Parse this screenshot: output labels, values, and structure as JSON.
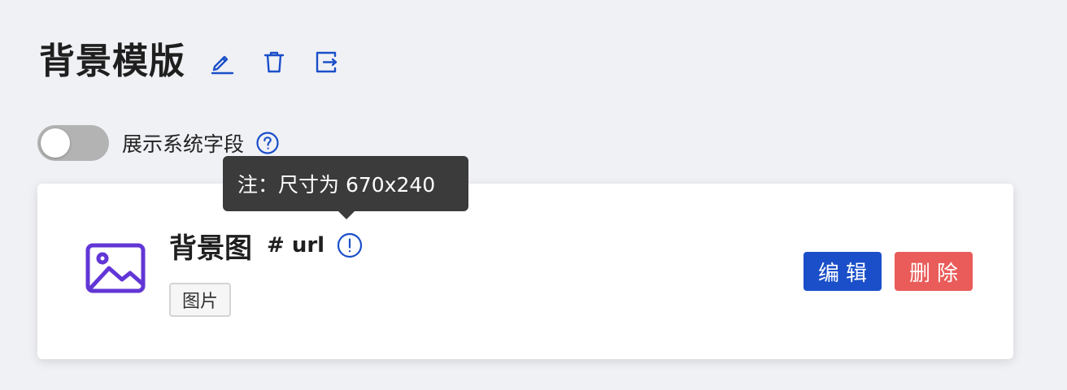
{
  "page": {
    "title": "背景模版",
    "header_icons": [
      "edit-icon",
      "trash-icon",
      "export-icon"
    ]
  },
  "toggle": {
    "label": "展示系统字段",
    "state": "off"
  },
  "tooltip": {
    "text": "注：尺寸为 670x240"
  },
  "field": {
    "icon": "image-icon",
    "name": "背景图",
    "key": "# url",
    "type_tag": "图片",
    "edit_label": "编辑",
    "delete_label": "删除"
  },
  "colors": {
    "background": "#f0f1f5",
    "accent_blue": "#1b4fc9",
    "danger_red": "#e95c59",
    "image_icon_purple": "#6236d6",
    "tooltip_bg": "#3b3b3b",
    "toggle_off": "#b3b3b3"
  }
}
